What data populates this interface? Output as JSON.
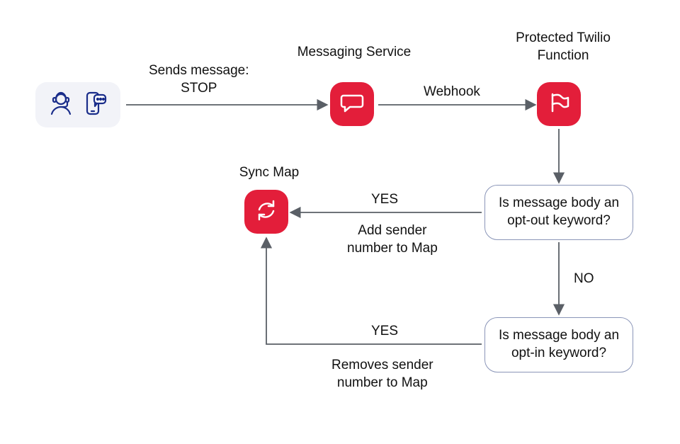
{
  "nodes": {
    "user": {
      "name": "user-sender-node"
    },
    "messaging": {
      "label": "Messaging Service",
      "name": "messaging-service-node"
    },
    "function": {
      "label": "Protected Twilio\nFunction",
      "name": "twilio-function-node"
    },
    "sync": {
      "label": "Sync Map",
      "name": "sync-map-node"
    },
    "optout": {
      "text": "Is message body an opt-out keyword?",
      "name": "optout-decision"
    },
    "optin": {
      "text": "Is message body an opt-in keyword?",
      "name": "optin-decision"
    }
  },
  "edges": {
    "user_to_messaging": "Sends message:\nSTOP",
    "messaging_to_function": "Webhook",
    "optout_yes": "YES",
    "optout_yes_sub": "Add sender\nnumber to Map",
    "optout_no": "NO",
    "optin_yes": "YES",
    "optin_yes_sub": "Removes sender\nnumber to Map"
  },
  "icons": {
    "user": "person-headset-icon",
    "phone": "phone-message-icon",
    "messaging": "chat-bubble-icon",
    "function": "function-flag-icon",
    "sync": "sync-arrows-icon"
  }
}
